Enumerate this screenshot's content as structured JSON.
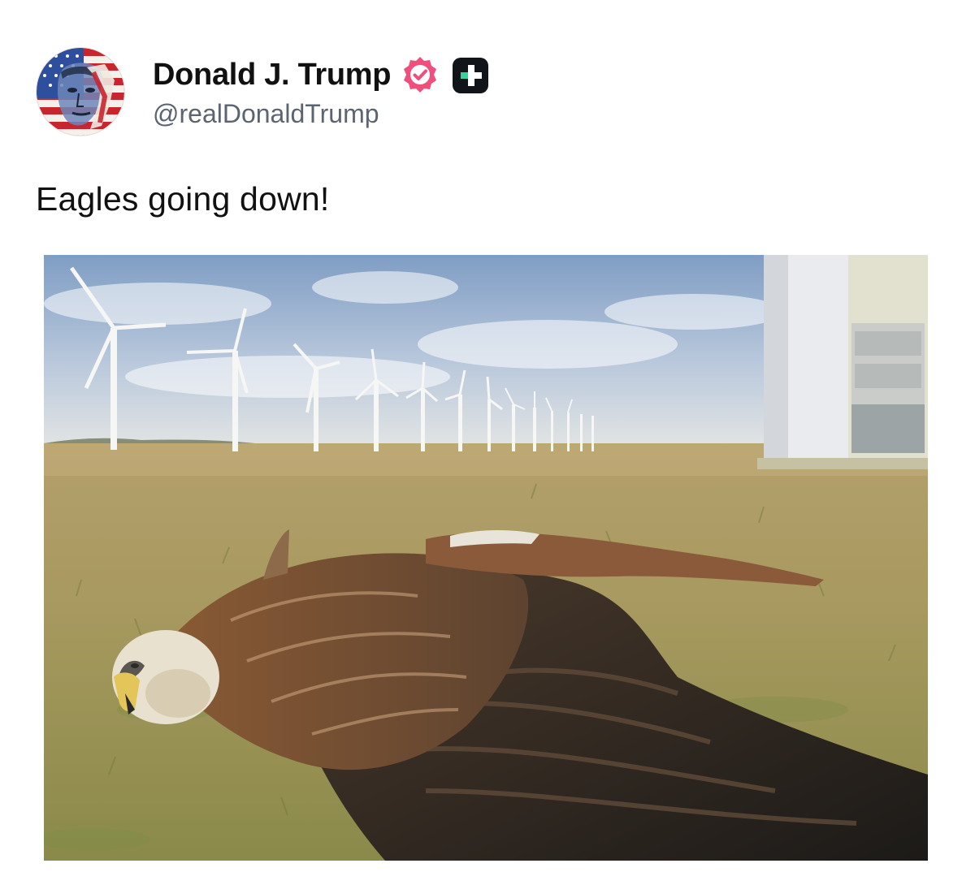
{
  "post": {
    "author": {
      "display_name": "Donald J. Trump",
      "handle": "@realDonaldTrump",
      "avatar_icon": "avatar-flag-portrait",
      "verified_badge_icon": "verified-check-icon",
      "verified_badge_color": "#ef4f7c",
      "plus_badge_icon": "plus-badge-icon",
      "plus_badge_color": "#111418",
      "plus_badge_accent": "#34d399"
    },
    "text": "Eagles going down!",
    "media": {
      "kind": "photo",
      "subject_icon": "dead-bird-wind-farm-photo"
    }
  },
  "colors": {
    "text_primary": "#111111",
    "text_secondary": "#5b6470",
    "background": "#ffffff"
  }
}
